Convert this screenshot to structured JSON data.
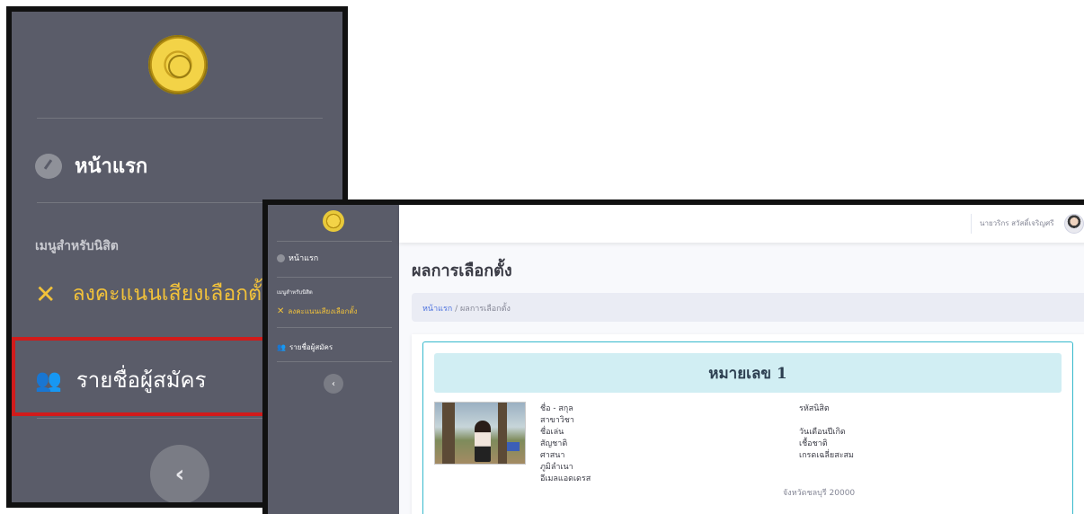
{
  "zoom": {
    "home_label": "หน้าแรก",
    "section_heading": "เมนูสำหรับนิสิต",
    "vote_label": "ลงคะแนนเสียงเลือกตั้ง",
    "candidates_label": "รายชื่อผู้สมัคร",
    "toggle_glyph": "‹",
    "highlight_color": "#d11b1b"
  },
  "sidebar": {
    "home_label": "หน้าแรก",
    "section_heading": "เมนูสำหรับนิสิต",
    "vote_label": "ลงคะแนนเสียงเลือกตั้ง",
    "candidates_label": "รายชื่อผู้สมัคร",
    "toggle_glyph": "‹",
    "bg_color": "#5a5c69",
    "accent_color": "#f2c23a"
  },
  "topbar": {
    "user_name": "นายวริกร สวัสดิ์เจริญศรี"
  },
  "main": {
    "page_title": "ผลการเลือกตั้ง",
    "breadcrumb_home": "หน้าแรก",
    "breadcrumb_sep": "/",
    "breadcrumb_current": "ผลการเลือกตั้ง",
    "card": {
      "banner": "หมายเลข 1",
      "left_fields": [
        "ชื่อ - สกุล",
        "สาขาวิชา",
        "ชื่อเล่น",
        "สัญชาติ",
        "ศาสนา",
        "ภูมิลำเนา",
        "อีเมลแอดเดรส"
      ],
      "right_fields": [
        "รหัสนิสิต",
        "",
        "วันเดือนปีเกิด",
        "เชื้อชาติ",
        "เกรดเฉลี่ยสะสม"
      ],
      "address_value": "จังหวัดชลบุรี 20000"
    }
  }
}
